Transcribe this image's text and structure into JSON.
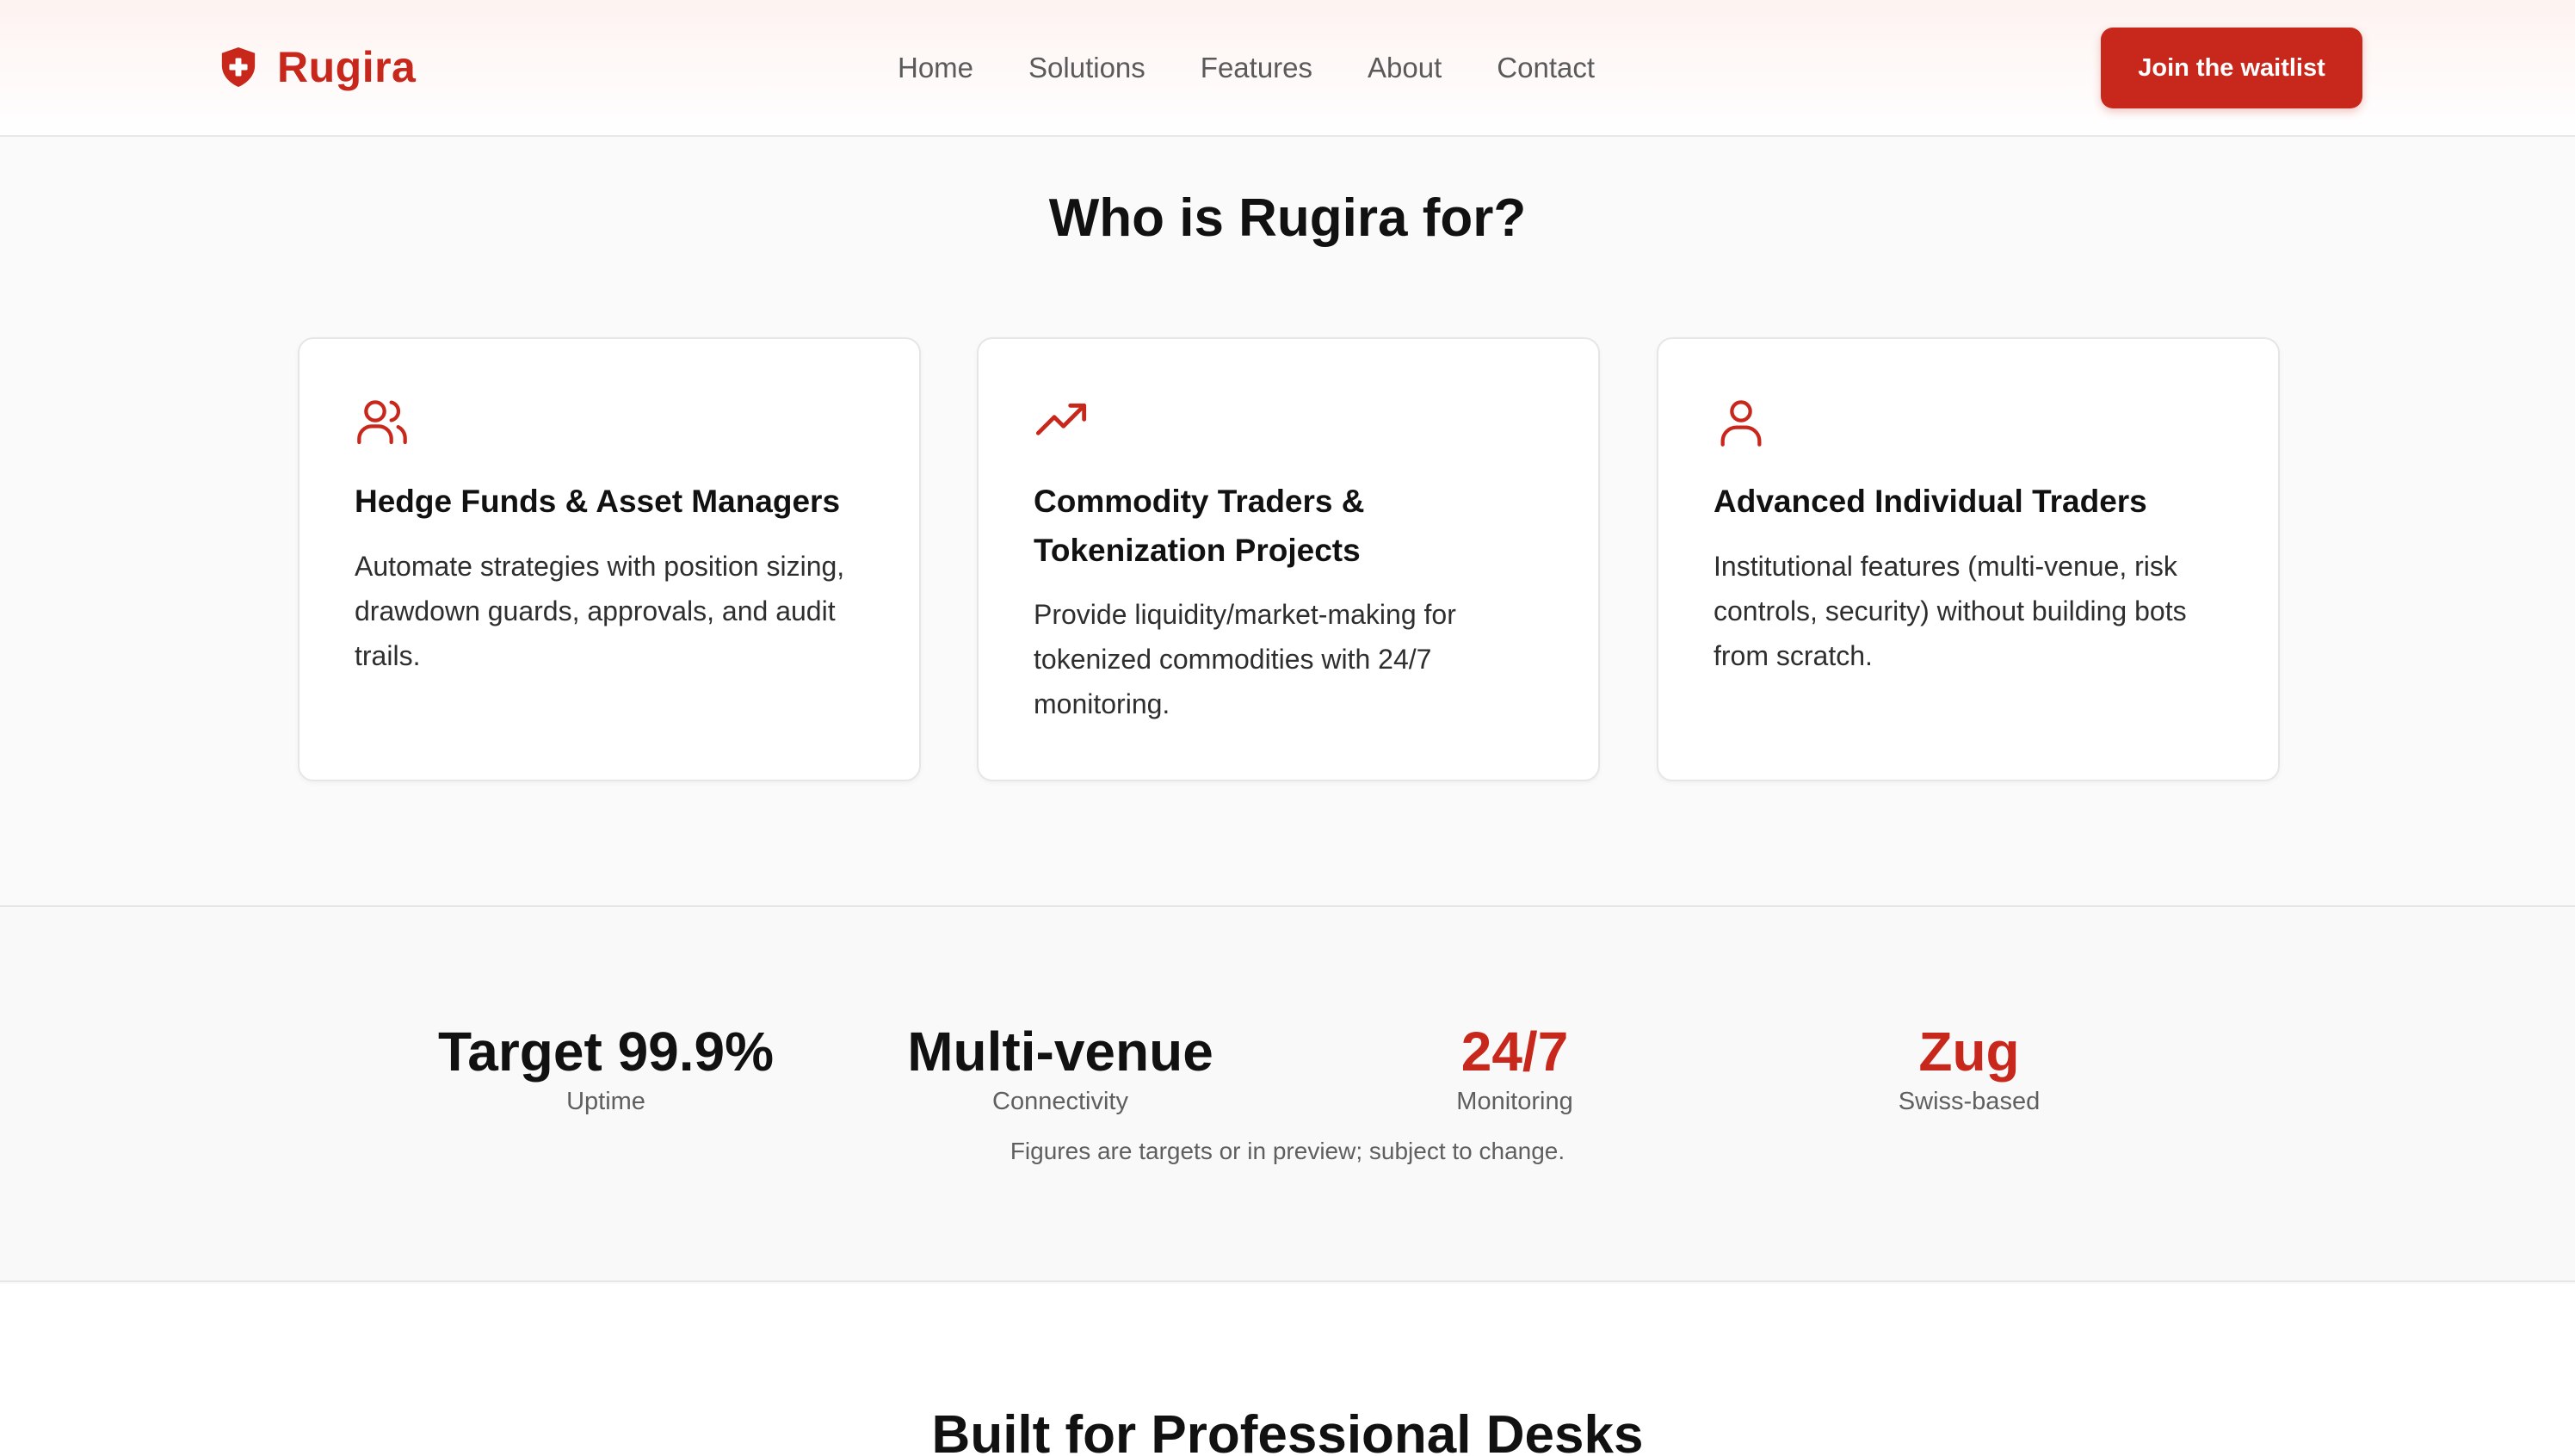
{
  "brand": {
    "name": "Rugira",
    "accent_color": "#c8281c",
    "logo_icon": "shield-plus-icon"
  },
  "nav": {
    "items": [
      "Home",
      "Solutions",
      "Features",
      "About",
      "Contact"
    ]
  },
  "cta": {
    "label": "Join the waitlist"
  },
  "audience": {
    "title": "Who is Rugira for?",
    "cards": [
      {
        "icon": "users-icon",
        "title": "Hedge Funds & Asset Managers",
        "description": "Automate strategies with position sizing, drawdown guards, approvals, and audit trails."
      },
      {
        "icon": "trending-up-icon",
        "title": "Commodity Traders & Tokenization Projects",
        "description": "Provide liquidity/market-making for tokenized commodities with 24/7 monitoring."
      },
      {
        "icon": "user-icon",
        "title": "Advanced Individual Traders",
        "description": "Institutional features (multi-venue, risk controls, security) without building bots from scratch."
      }
    ]
  },
  "stats": {
    "items": [
      {
        "value": "Target 99.9%",
        "label": "Uptime",
        "accent": false
      },
      {
        "value": "Multi-venue",
        "label": "Connectivity",
        "accent": false
      },
      {
        "value": "24/7",
        "label": "Monitoring",
        "accent": true
      },
      {
        "value": "Zug",
        "label": "Swiss-based",
        "accent": true
      }
    ],
    "note": "Figures are targets or in preview; subject to change."
  },
  "built": {
    "title": "Built for Professional Desks"
  }
}
